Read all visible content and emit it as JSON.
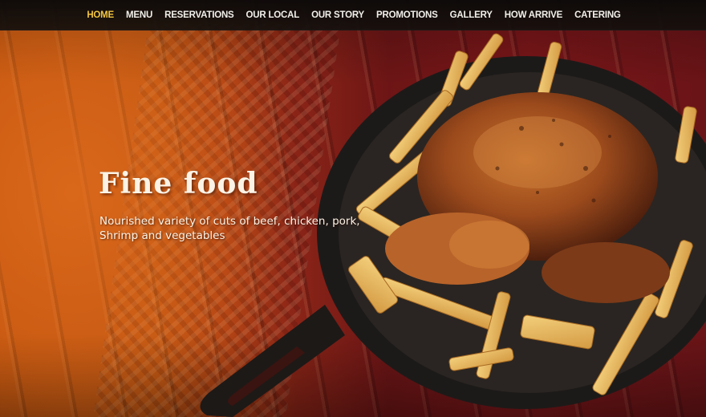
{
  "nav": {
    "items": [
      {
        "label": "HOME",
        "active": true
      },
      {
        "label": "MENU",
        "active": false
      },
      {
        "label": "RESERVATIONS",
        "active": false
      },
      {
        "label": "OUR LOCAL",
        "active": false
      },
      {
        "label": "OUR STORY",
        "active": false
      },
      {
        "label": "PROMOTIONS",
        "active": false
      },
      {
        "label": "GALLERY",
        "active": false
      },
      {
        "label": "HOW ARRIVE",
        "active": false
      },
      {
        "label": "CATERING",
        "active": false
      }
    ],
    "active_color": "#f2c541",
    "text_color": "#f2f0ea"
  },
  "hero": {
    "title": "Fine food",
    "subtitle": "Nourished variety of cuts of beef, chicken, pork, Shrimp and vegetables",
    "image": "roast-chicken-with-fries-in-skillet"
  }
}
